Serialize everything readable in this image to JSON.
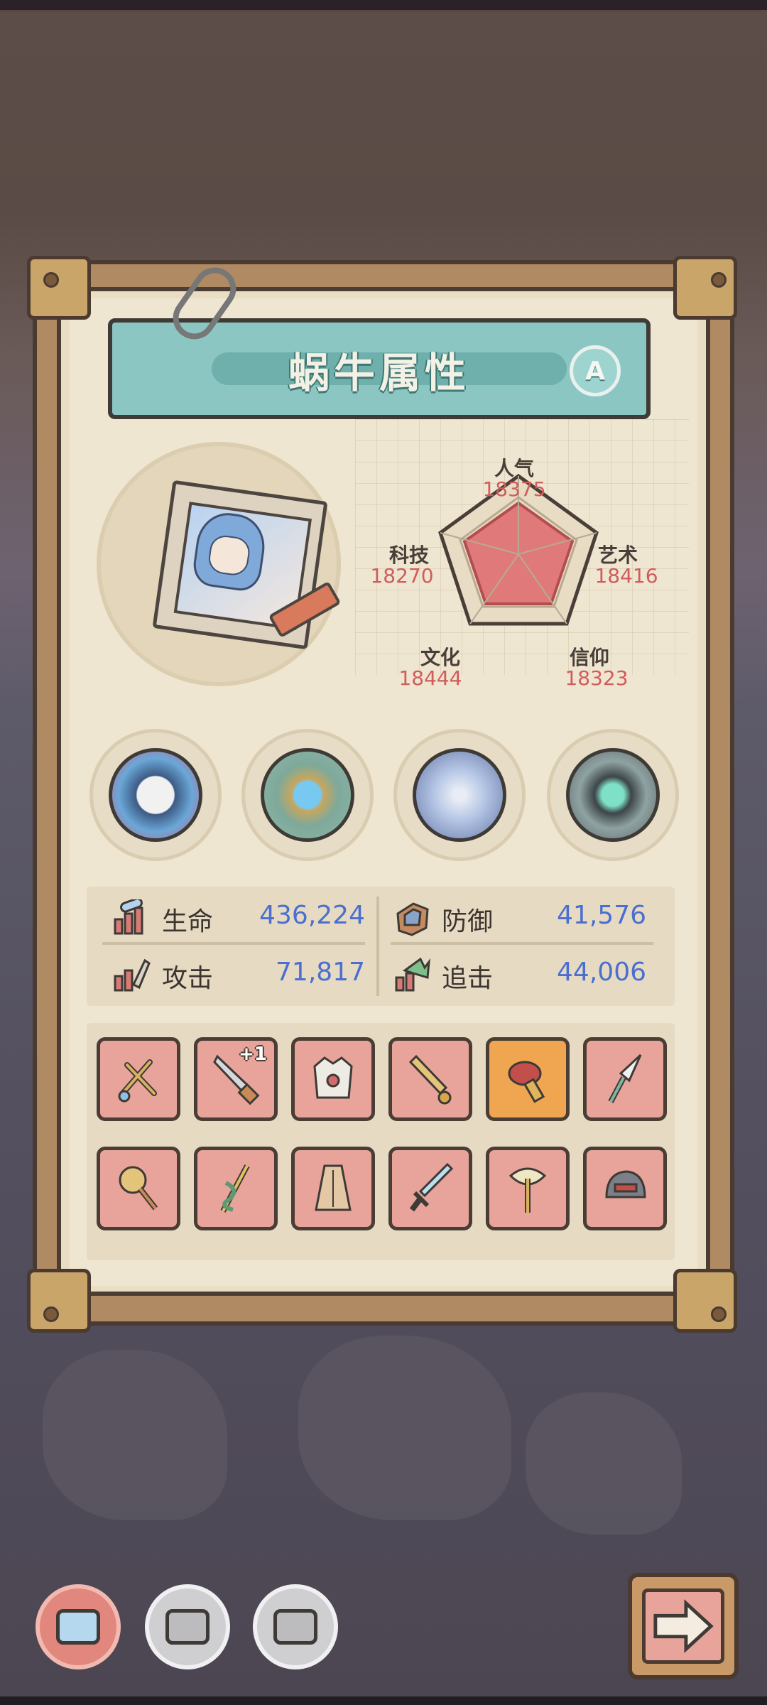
{
  "title": "蜗牛属性",
  "grade": "A",
  "attributes": [
    {
      "label": "人气",
      "value": "18375"
    },
    {
      "label": "艺术",
      "value": "18416"
    },
    {
      "label": "信仰",
      "value": "18323"
    },
    {
      "label": "文化",
      "value": "18444"
    },
    {
      "label": "科技",
      "value": "18270"
    }
  ],
  "equipment_slots": [
    {
      "icon": "spiked-wreath-icon"
    },
    {
      "icon": "gem-shell-icon"
    },
    {
      "icon": "compass-icon"
    },
    {
      "icon": "swirl-orb-icon"
    }
  ],
  "stats": [
    {
      "name": "生命",
      "value": "436,224",
      "icon": "health-icon"
    },
    {
      "name": "防御",
      "value": "41,576",
      "icon": "defense-icon"
    },
    {
      "name": "攻击",
      "value": "71,817",
      "icon": "attack-icon"
    },
    {
      "name": "追击",
      "value": "44,006",
      "icon": "pursuit-icon"
    }
  ],
  "items_row1": [
    {
      "icon": "slingshot-icon",
      "badge": ""
    },
    {
      "icon": "dagger-icon",
      "badge": "+1"
    },
    {
      "icon": "armor-vest-icon",
      "badge": ""
    },
    {
      "icon": "torch-blade-icon",
      "badge": ""
    },
    {
      "icon": "blaster-icon",
      "badge": "",
      "highlight": true
    },
    {
      "icon": "spear-tip-icon",
      "badge": ""
    }
  ],
  "items_row2": [
    {
      "icon": "mace-icon",
      "badge": ""
    },
    {
      "icon": "serpent-staff-icon",
      "badge": ""
    },
    {
      "icon": "cloak-icon",
      "badge": ""
    },
    {
      "icon": "sword-icon",
      "badge": ""
    },
    {
      "icon": "axe-icon",
      "badge": ""
    },
    {
      "icon": "helmet-icon",
      "badge": ""
    }
  ],
  "bottom_tabs": [
    {
      "icon": "chip-icon-1",
      "active": true
    },
    {
      "icon": "chip-icon-2",
      "active": false
    },
    {
      "icon": "chip-icon-3",
      "active": false
    }
  ],
  "next_button": {
    "icon": "arrow-right-icon"
  },
  "colors": {
    "accent_teal": "#8cc6c2",
    "item_red": "#e8a49a",
    "item_gold": "#f0a651",
    "stat_blue": "#4a6fd0",
    "attr_red": "#d05c5c"
  }
}
